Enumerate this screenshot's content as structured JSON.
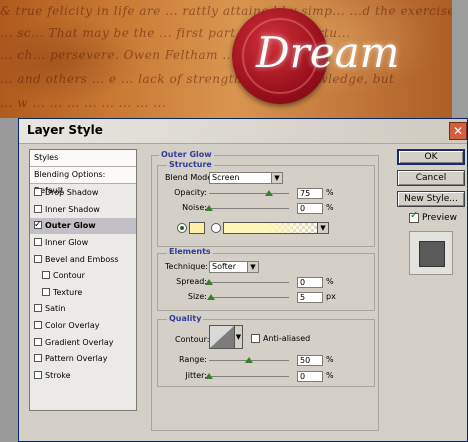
{
  "background": {
    "script_lines": [
      "& true felicity in life are ... rattly attained by simp... ...d the exercise of",
      "... sc... That may be the ... first part be ... ...ly virtu...",
      "... ch... persevere. Owen Feltham ... beneveland ...",
      "... and others ... e ... lack of strength, not ... knowledge, but",
      "... w ... ... ... ... ... ... ... ..."
    ],
    "logo_text": "Dream"
  },
  "dialog": {
    "title": "Layer Style",
    "close_glyph": "✕"
  },
  "styles_list": [
    {
      "label": "Styles",
      "checkbox": false,
      "checked": false,
      "selected": false,
      "indent": 0,
      "header": true
    },
    {
      "label": "Blending Options: Default",
      "checkbox": false,
      "checked": false,
      "selected": false,
      "indent": 0,
      "header": true
    },
    {
      "label": "Drop Shadow",
      "checkbox": true,
      "checked": false,
      "selected": false,
      "indent": 0
    },
    {
      "label": "Inner Shadow",
      "checkbox": true,
      "checked": false,
      "selected": false,
      "indent": 0
    },
    {
      "label": "Outer Glow",
      "checkbox": true,
      "checked": true,
      "selected": true,
      "indent": 0
    },
    {
      "label": "Inner Glow",
      "checkbox": true,
      "checked": false,
      "selected": false,
      "indent": 0
    },
    {
      "label": "Bevel and Emboss",
      "checkbox": true,
      "checked": false,
      "selected": false,
      "indent": 0
    },
    {
      "label": "Contour",
      "checkbox": true,
      "checked": false,
      "selected": false,
      "indent": 1
    },
    {
      "label": "Texture",
      "checkbox": true,
      "checked": false,
      "selected": false,
      "indent": 1
    },
    {
      "label": "Satin",
      "checkbox": true,
      "checked": false,
      "selected": false,
      "indent": 0
    },
    {
      "label": "Color Overlay",
      "checkbox": true,
      "checked": false,
      "selected": false,
      "indent": 0
    },
    {
      "label": "Gradient Overlay",
      "checkbox": true,
      "checked": false,
      "selected": false,
      "indent": 0
    },
    {
      "label": "Pattern Overlay",
      "checkbox": true,
      "checked": false,
      "selected": false,
      "indent": 0
    },
    {
      "label": "Stroke",
      "checkbox": true,
      "checked": false,
      "selected": false,
      "indent": 0
    }
  ],
  "outer_glow": {
    "title": "Outer Glow",
    "structure": {
      "title": "Structure",
      "blend_mode_label": "Blend Mode:",
      "blend_mode_value": "Screen",
      "opacity_label": "Opacity:",
      "opacity_value": "75",
      "opacity_fraction": 0.75,
      "noise_label": "Noise:",
      "noise_value": "0",
      "noise_fraction": 0.0,
      "percent_unit": "%",
      "glow_color": "#fbf0a6",
      "color_radio_selected": true,
      "gradient_radio_selected": false
    },
    "elements": {
      "title": "Elements",
      "technique_label": "Technique:",
      "technique_value": "Softer",
      "spread_label": "Spread:",
      "spread_value": "0",
      "spread_fraction": 0.0,
      "spread_unit": "%",
      "size_label": "Size:",
      "size_value": "5",
      "size_fraction": 0.02,
      "size_unit": "px"
    },
    "quality": {
      "title": "Quality",
      "contour_label": "Contour:",
      "anti_aliased_label": "Anti-aliased",
      "anti_aliased_checked": false,
      "range_label": "Range:",
      "range_value": "50",
      "range_fraction": 0.5,
      "range_unit": "%",
      "jitter_label": "Jitter:",
      "jitter_value": "0",
      "jitter_fraction": 0.0,
      "jitter_unit": "%"
    }
  },
  "buttons": {
    "ok": "OK",
    "cancel": "Cancel",
    "new_style": "New Style...",
    "preview_label": "Preview",
    "preview_checked": true
  }
}
